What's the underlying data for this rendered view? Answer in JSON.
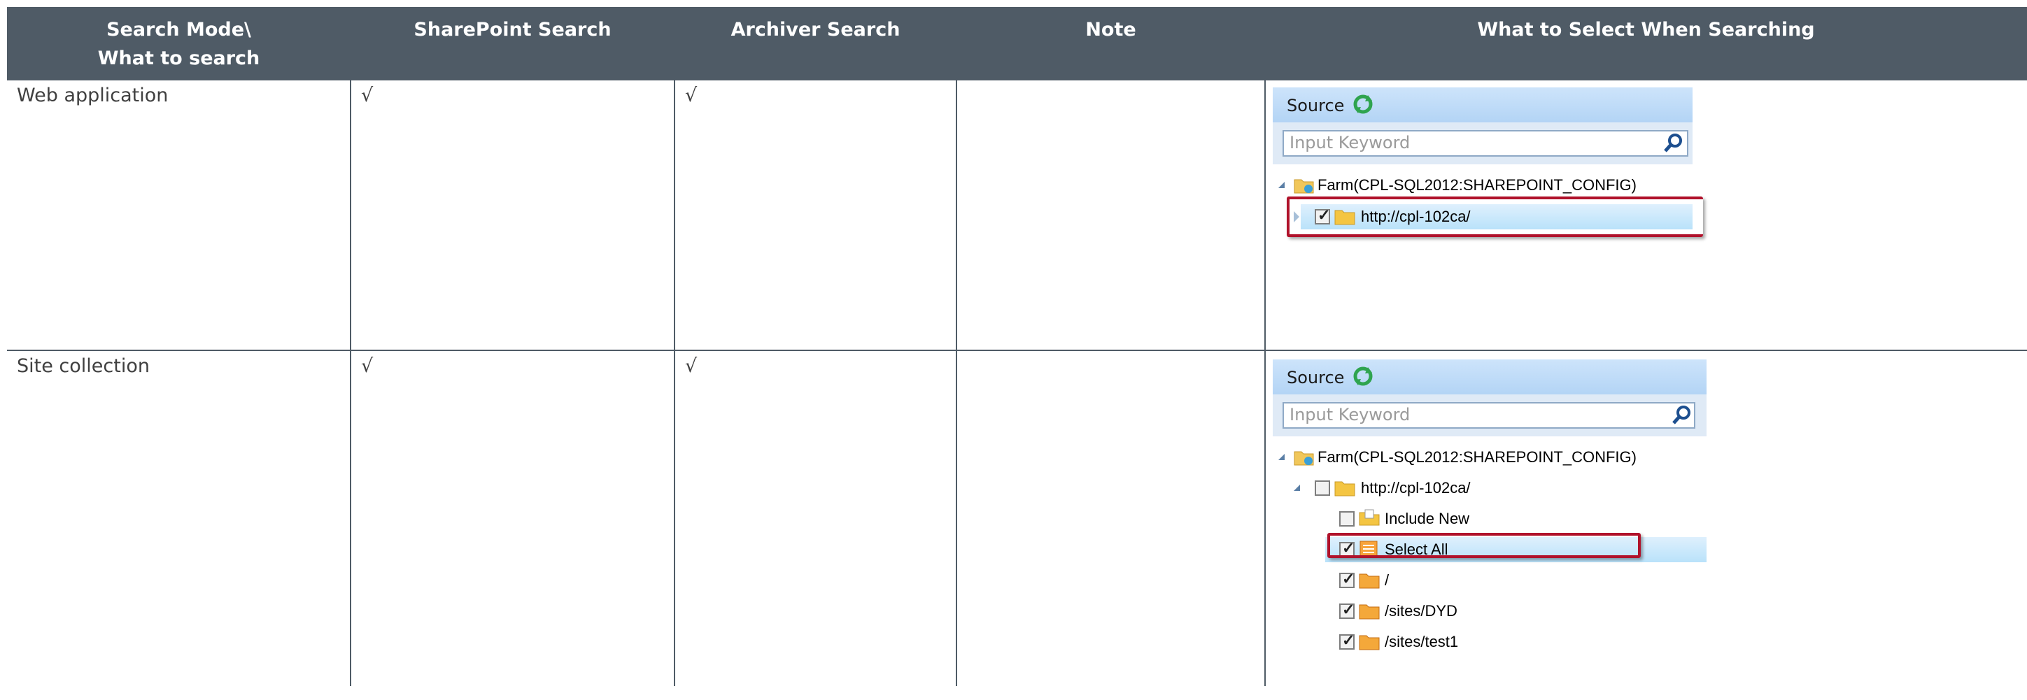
{
  "table": {
    "headers": [
      {
        "line1": "Search Mode\\",
        "line2": "What to search"
      },
      {
        "line1": "SharePoint Search",
        "line2": ""
      },
      {
        "line1": "Archiver Search",
        "line2": ""
      },
      {
        "line1": "Note",
        "line2": ""
      },
      {
        "line1": "What to Select When Searching",
        "line2": ""
      }
    ],
    "rows": [
      {
        "mode": "Web application",
        "sharepoint": "√",
        "archiver": "√",
        "note": ""
      },
      {
        "mode": "Site collection",
        "sharepoint": "√",
        "archiver": "√",
        "note": ""
      }
    ]
  },
  "screenshot1": {
    "source_label": "Source",
    "keyword_placeholder": "Input Keyword",
    "farm_label": "Farm(CPL-SQL2012:SHAREPOINT_CONFIG)",
    "webapp_label": "http://cpl-102ca/"
  },
  "screenshot2": {
    "source_label": "Source",
    "keyword_placeholder": "Input Keyword",
    "farm_label": "Farm(CPL-SQL2012:SHAREPOINT_CONFIG)",
    "webapp_label": "http://cpl-102ca/",
    "include_new_label": "Include New",
    "select_all_label": "Select All",
    "sites": [
      "/",
      "/sites/DYD",
      "/sites/test1"
    ]
  }
}
